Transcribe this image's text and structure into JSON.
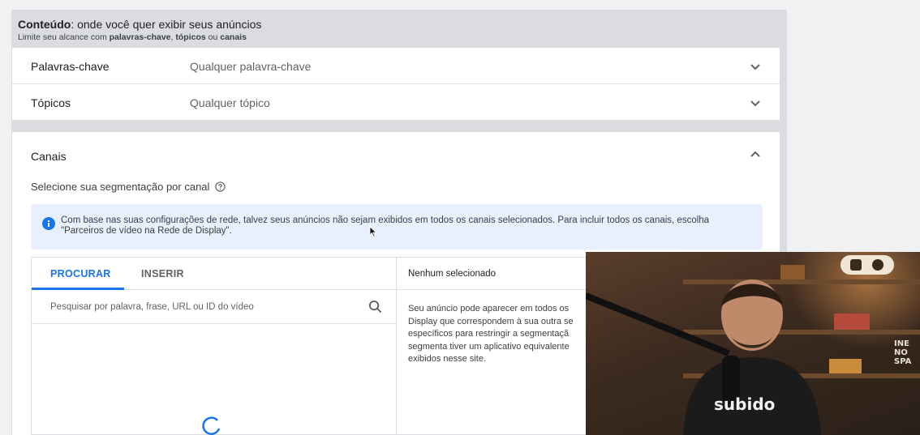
{
  "content_section": {
    "title_bold": "Conteúdo",
    "title_rest": ": onde você quer exibir seus anúncios",
    "subtitle_prefix": "Limite seu alcance com ",
    "subtitle_kw": "palavras-chave",
    "subtitle_sep1": ", ",
    "subtitle_topics": "tópicos",
    "subtitle_sep2": " ou ",
    "subtitle_channels": "canais"
  },
  "rows": [
    {
      "label": "Palavras-chave",
      "value": "Qualquer palavra-chave",
      "chevron_icon": "chevron-down-icon"
    },
    {
      "label": "Tópicos",
      "value": "Qualquer tópico",
      "chevron_icon": "chevron-down-icon"
    }
  ],
  "channels": {
    "label": "Canais",
    "chevron_icon": "chevron-up-icon",
    "hint": "Selecione sua segmentação por canal",
    "info_text": "Com base nas suas configurações de rede, talvez seus anúncios não sejam exibidos em todos os canais selecionados. Para incluir todos os canais, escolha \"Parceiros de vídeo na Rede de Display\".",
    "tabs": [
      "PROCURAR",
      "INSERIR"
    ],
    "active_tab": "PROCURAR",
    "search_placeholder": "Pesquisar por palavra, frase, URL ou ID do vídeo",
    "selected_header": "Nenhum selecionado",
    "selected_desc": "Seu anúncio pode aparecer em todos os Display que correspondem à sua outra se específicos para restringir a segmentaçã segmenta tiver um aplicativo equivalente exibidos nesse site."
  },
  "webcam": {
    "shirt_text": "subido",
    "sign_lines": [
      "INE",
      "NO",
      "SPA"
    ]
  },
  "colors": {
    "accent": "#1a73e8",
    "info_bg": "#e8f0fe",
    "panel_bg": "#dadce0"
  }
}
